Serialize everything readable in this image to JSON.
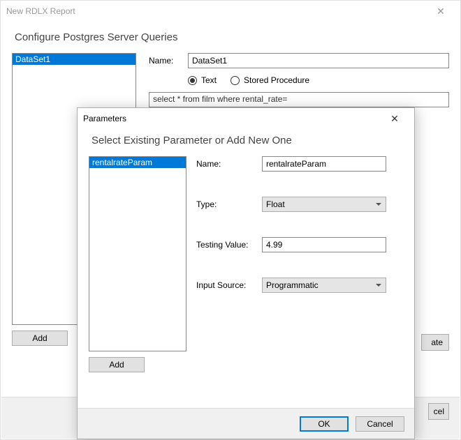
{
  "parent": {
    "title": "New RDLX Report",
    "heading": "Configure Postgres Server Queries",
    "list_item": "DataSet1",
    "add_label": "Add",
    "form": {
      "name_label": "Name:",
      "name_value": "DataSet1",
      "radio_text": "Text",
      "radio_stored": "Stored Procedure",
      "query": "select * from film where rental_rate="
    },
    "partial_btn1": "ate",
    "partial_btn2": "cel"
  },
  "modal": {
    "title": "Parameters",
    "heading": "Select Existing Parameter or Add New One",
    "list_item": "rentalrateParam",
    "add_label": "Add",
    "form": {
      "name_label": "Name:",
      "name_value": "rentalrateParam",
      "type_label": "Type:",
      "type_value": "Float",
      "testing_label": "Testing Value:",
      "testing_value": "4.99",
      "source_label": "Input Source:",
      "source_value": "Programmatic"
    },
    "ok_label": "OK",
    "cancel_label": "Cancel"
  }
}
